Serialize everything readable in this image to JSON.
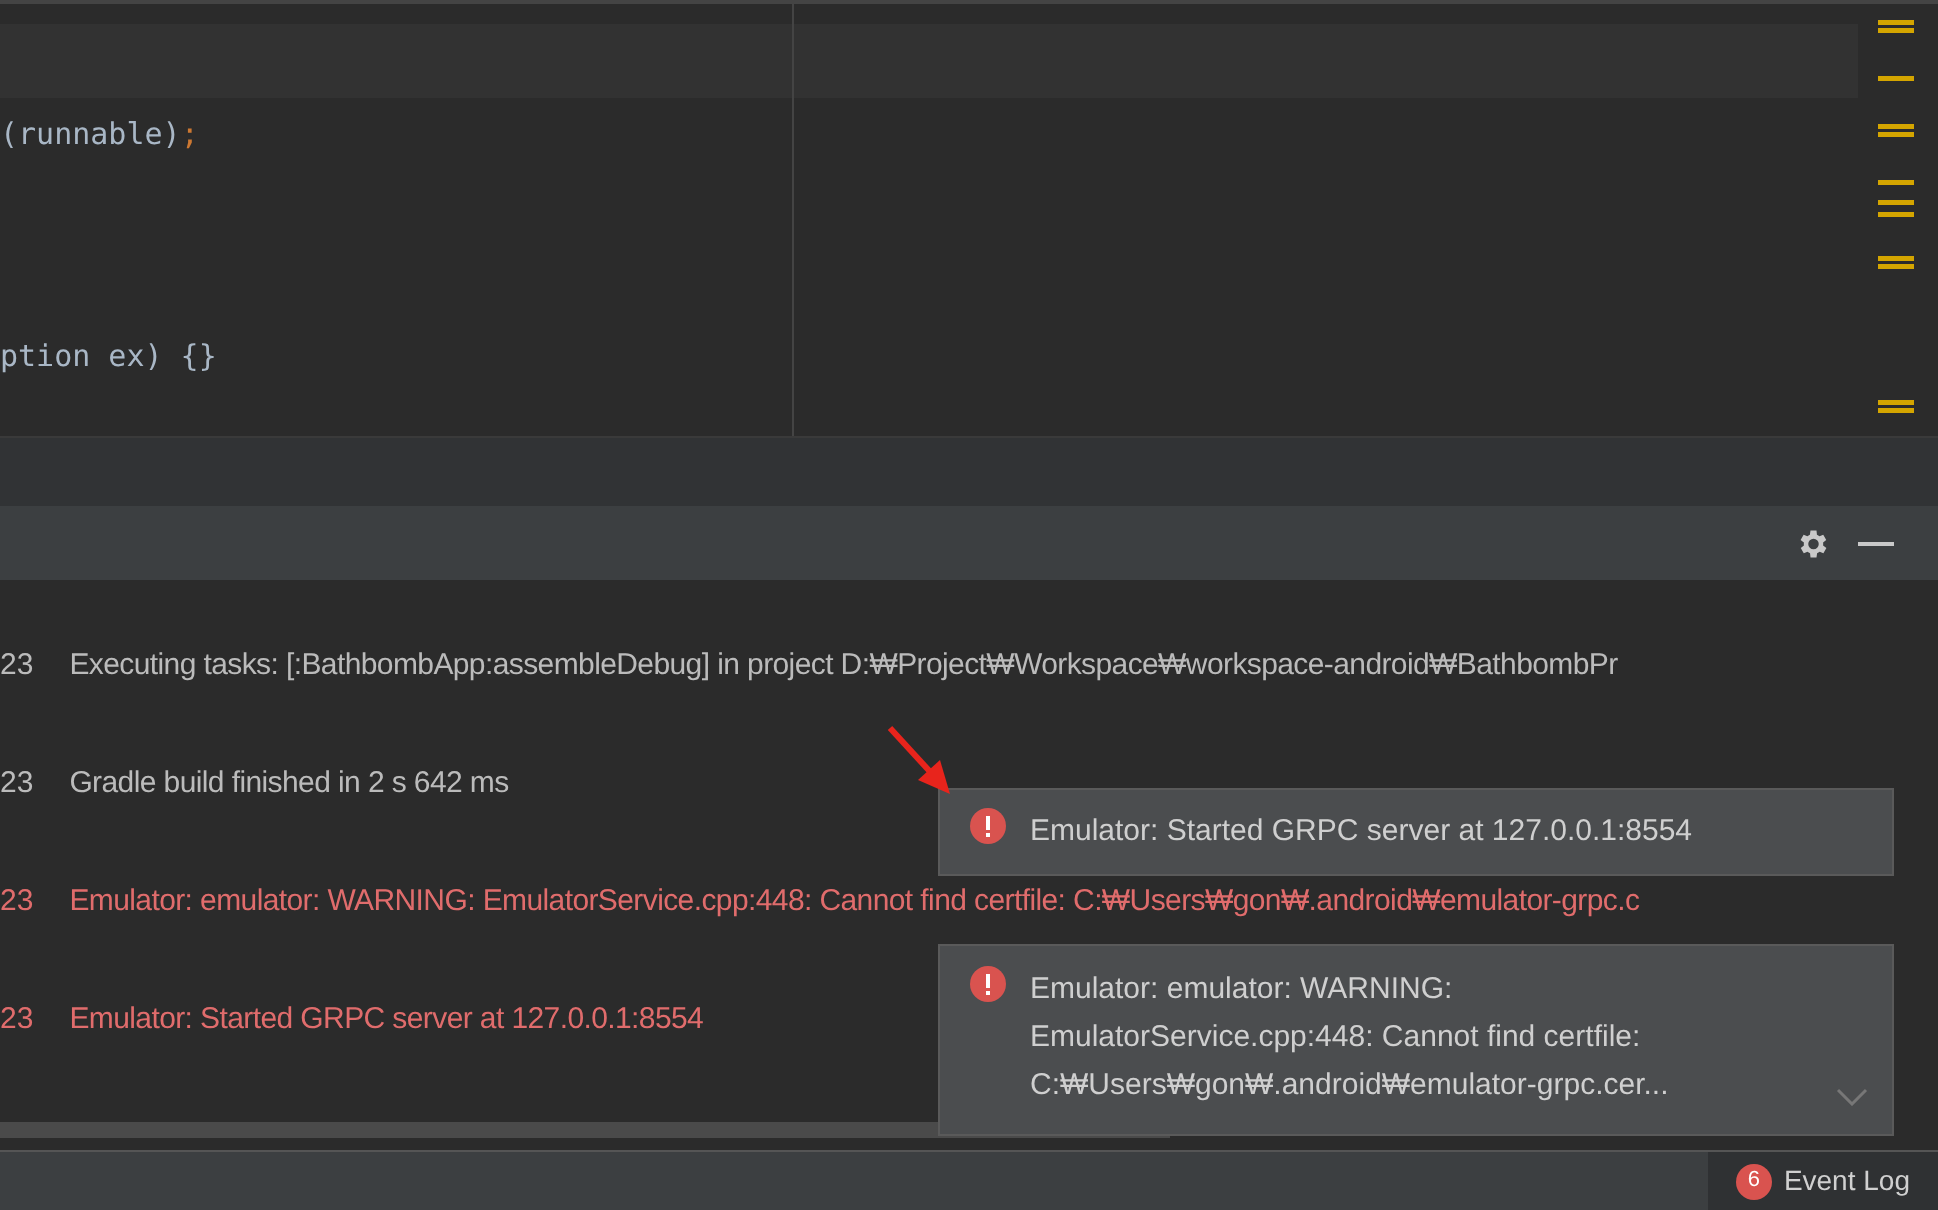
{
  "editor": {
    "lines": [
      {
        "text": "(runnable)",
        "punct": ";"
      },
      {
        "text": "ption ex) {}"
      }
    ]
  },
  "console": {
    "lines": [
      {
        "time": "23",
        "text": "Executing tasks: [:BathbombApp:assembleDebug] in project D:₩Project₩Workspace₩workspace-android₩BathbombPr",
        "kind": "info"
      },
      {
        "time": "23",
        "text": "Gradle build finished in 2 s 642 ms",
        "kind": "info"
      },
      {
        "time": "23",
        "text": "Emulator: emulator: WARNING: EmulatorService.cpp:448: Cannot find certfile: C:₩Users₩gon₩.android₩emulator-grpc.c",
        "kind": "error"
      },
      {
        "time": "23",
        "text": "Emulator: Started GRPC server at 127.0.0.1:8554",
        "kind": "error"
      }
    ]
  },
  "notifications": [
    {
      "lines": [
        "Emulator: Started GRPC server at 127.0.0.1:8554"
      ],
      "expandable": false
    },
    {
      "lines": [
        "Emulator: emulator: WARNING:",
        "EmulatorService.cpp:448: Cannot find certfile:",
        "C:₩Users₩gon₩.android₩emulator-grpc.cer..."
      ],
      "expandable": true
    }
  ],
  "status_bar": {
    "event_log": {
      "count": "6",
      "label": "Event Log"
    }
  }
}
